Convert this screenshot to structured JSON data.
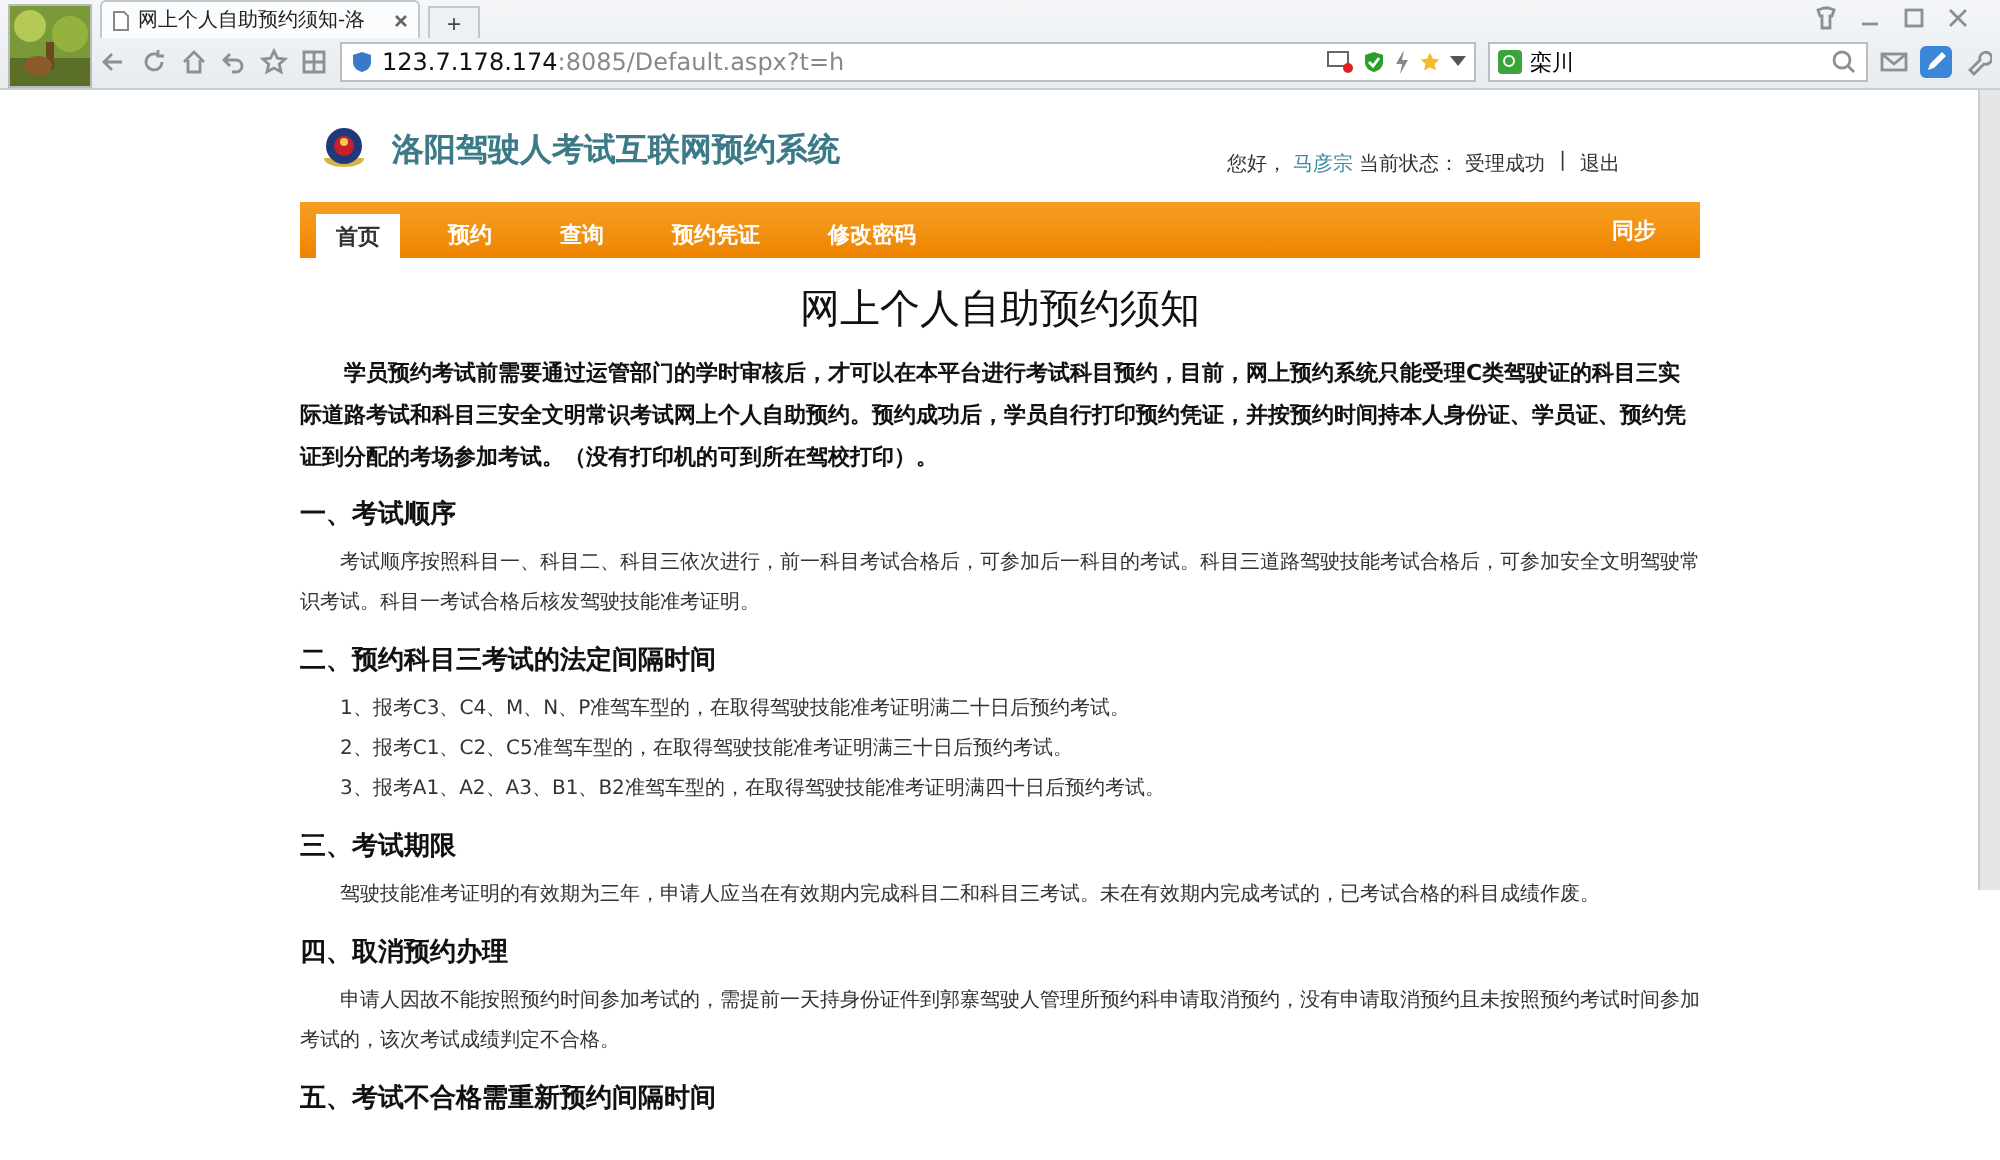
{
  "browser": {
    "tab_title": "网上个人自助预约须知-洛",
    "new_tab": "+",
    "url_host": "123.7.178.174",
    "url_rest": ":8085/Default.aspx?t=h",
    "search_value": "栾川"
  },
  "site": {
    "title": "洛阳驾驶人考试互联网预约系统",
    "greeting": "您好，",
    "user": "马彦宗",
    "status_label": "当前状态：",
    "status": "受理成功",
    "separator": "|",
    "logout": "退出",
    "nav": [
      {
        "label": "首页",
        "selected": true
      },
      {
        "label": "预约",
        "selected": false
      },
      {
        "label": "查询",
        "selected": false
      },
      {
        "label": "预约凭证",
        "selected": false
      },
      {
        "label": "修改密码",
        "selected": false
      }
    ],
    "nav_right": "同步"
  },
  "notice": {
    "title": "网上个人自助预约须知",
    "intro": "学员预约考试前需要通过运管部门的学时审核后，才可以在本平台进行考试科目预约，目前，网上预约系统只能受理C类驾驶证的科目三实际道路考试和科目三安全文明常识考试网上个人自助预约。预约成功后，学员自行打印预约凭证，并按预约时间持本人身份证、学员证、预约凭证到分配的考场参加考试。（没有打印机的可到所在驾校打印）。",
    "sections": [
      {
        "heading": "一、考试顺序",
        "paragraphs": [
          "考试顺序按照科目一、科目二、科目三依次进行，前一科目考试合格后，可参加后一科目的考试。科目三道路驾驶技能考试合格后，可参加安全文明驾驶常识考试。科目一考试合格后核发驾驶技能准考证明。"
        ]
      },
      {
        "heading": "二、预约科目三考试的法定间隔时间",
        "items": [
          "1、报考C3、C4、M、N、P准驾车型的，在取得驾驶技能准考证明满二十日后预约考试。",
          "2、报考C1、C2、C5准驾车型的，在取得驾驶技能准考证明满三十日后预约考试。",
          "3、报考A1、A2、A3、B1、B2准驾车型的，在取得驾驶技能准考证明满四十日后预约考试。"
        ]
      },
      {
        "heading": "三、考试期限",
        "paragraphs": [
          "驾驶技能准考证明的有效期为三年，申请人应当在有效期内完成科目二和科目三考试。未在有效期内完成考试的，已考试合格的科目成绩作废。"
        ]
      },
      {
        "heading": "四、取消预约办理",
        "paragraphs": [
          "申请人因故不能按照预约时间参加考试的，需提前一天持身份证件到郭寨驾驶人管理所预约科申请取消预约，没有申请取消预约且未按照预约考试时间参加考试的，该次考试成绩判定不合格。"
        ]
      },
      {
        "heading": "五、考试不合格需重新预约间隔时间"
      }
    ]
  }
}
